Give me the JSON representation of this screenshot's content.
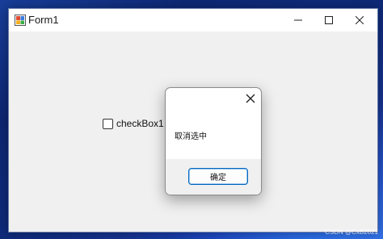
{
  "window": {
    "title": "Form1",
    "icon": "winforms-app-icon",
    "controls": {
      "minimize": "minimize-icon",
      "maximize": "maximize-icon",
      "close": "close-icon"
    }
  },
  "form": {
    "checkbox": {
      "label": "checkBox1",
      "checked": false
    }
  },
  "dialog": {
    "message": "取消选中",
    "ok_label": "确定",
    "close_icon": "close-icon"
  },
  "watermark": {
    "text": "CSDN @CxB2021"
  },
  "colors": {
    "accent": "#0067c0",
    "window_bg": "#f0f0f0",
    "titlebar": "#ffffff"
  }
}
